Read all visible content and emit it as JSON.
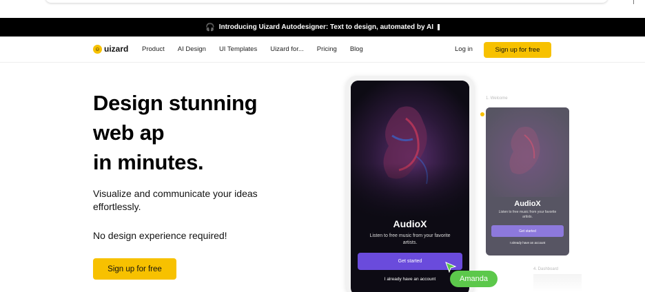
{
  "banner": {
    "icon": "headphones-icon",
    "text": "Introducing Uizard Autodesigner: Text to design, automated by AI"
  },
  "nav": {
    "logo_text": "uizard",
    "links": [
      "Product",
      "AI Design",
      "UI Templates",
      "Uizard for...",
      "Pricing",
      "Blog"
    ],
    "login": "Log in",
    "signup": "Sign up for free"
  },
  "hero": {
    "title_line1": "Design stunning",
    "title_line2": "web ap",
    "title_line3": "in minutes.",
    "subtitle": "Visualize and communicate your ideas effortlessly.",
    "subtitle2": "No design experience required!",
    "cta": "Sign up for free"
  },
  "phone": {
    "app_title": "AudioX",
    "app_desc": "Listen to free music from your favorite artists.",
    "btn_start": "Get started",
    "btn_account": "I already have an account"
  },
  "collab": {
    "cursor_name": "Amanda",
    "color": "#5cc84b"
  },
  "preview": {
    "label1": "1. Welcome",
    "app_title": "AudioX",
    "app_desc": "Listen to free music from your favorite artists.",
    "btn_start": "Get started",
    "btn_account": "I already have an account",
    "label2": "4. Dashboard"
  },
  "colors": {
    "brand": "#f7c100",
    "accent": "#6a4bdc",
    "banner_bg": "#000000"
  }
}
